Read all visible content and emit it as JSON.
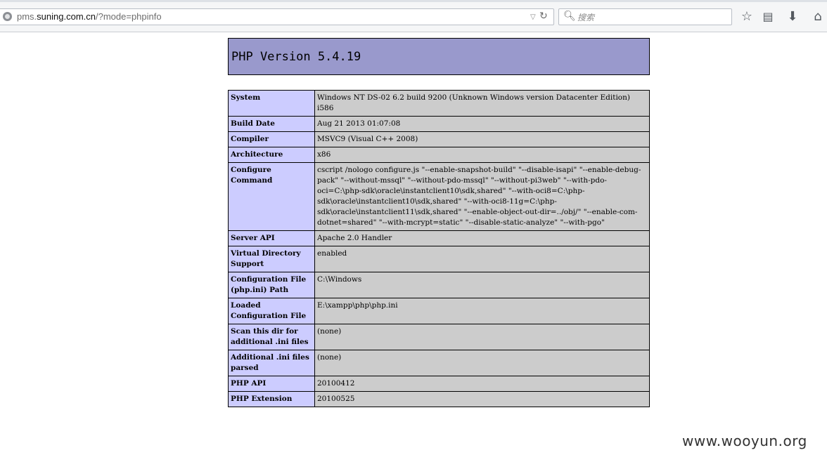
{
  "browser": {
    "url_prefix": "pms.",
    "url_host": "suning.com.cn",
    "url_path": "/?mode=phpinfo",
    "search_placeholder": "搜索"
  },
  "icons": {
    "site": "globe-icon",
    "dropdown": "chevron-down-icon",
    "reload": "reload-icon",
    "search": "search-icon",
    "bookmark": "star-icon",
    "reading_list": "clipboard-icon",
    "download": "download-arrow-icon",
    "home": "home-icon"
  },
  "colors": {
    "header_bg": "#9999cc",
    "label_bg": "#ccccff",
    "value_bg": "#cccccc"
  },
  "phpinfo": {
    "title": "PHP Version 5.4.19",
    "rows": [
      {
        "label": "System",
        "value": "Windows NT DS-02 6.2 build 9200 (Unknown Windows version Datacenter Edition) i586"
      },
      {
        "label": "Build Date",
        "value": "Aug 21 2013 01:07:08"
      },
      {
        "label": "Compiler",
        "value": "MSVC9 (Visual C++ 2008)"
      },
      {
        "label": "Architecture",
        "value": "x86"
      },
      {
        "label": "Configure Command",
        "value": "cscript /nologo configure.js \"--enable-snapshot-build\" \"--disable-isapi\" \"--enable-debug-pack\" \"--without-mssql\" \"--without-pdo-mssql\" \"--without-pi3web\" \"--with-pdo-oci=C:\\php-sdk\\oracle\\instantclient10\\sdk,shared\" \"--with-oci8=C:\\php-sdk\\oracle\\instantclient10\\sdk,shared\" \"--with-oci8-11g=C:\\php-sdk\\oracle\\instantclient11\\sdk,shared\" \"--enable-object-out-dir=../obj/\" \"--enable-com-dotnet=shared\" \"--with-mcrypt=static\" \"--disable-static-analyze\" \"--with-pgo\""
      },
      {
        "label": "Server API",
        "value": "Apache 2.0 Handler"
      },
      {
        "label": "Virtual Directory Support",
        "value": "enabled"
      },
      {
        "label": "Configuration File (php.ini) Path",
        "value": "C:\\Windows"
      },
      {
        "label": "Loaded Configuration File",
        "value": "E:\\xampp\\php\\php.ini"
      },
      {
        "label": "Scan this dir for additional .ini files",
        "value": "(none)"
      },
      {
        "label": "Additional .ini files parsed",
        "value": "(none)"
      },
      {
        "label": "PHP API",
        "value": "20100412"
      },
      {
        "label": "PHP Extension",
        "value": "20100525"
      }
    ]
  },
  "watermark": "www.wooyun.org"
}
